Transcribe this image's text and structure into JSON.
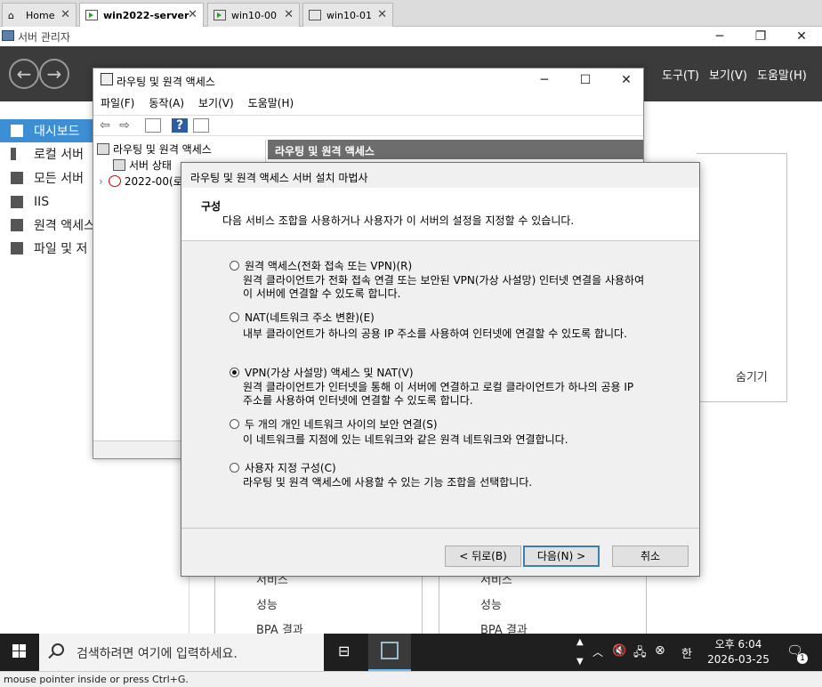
{
  "vm_tabs": [
    {
      "label": "Home"
    },
    {
      "label": "win2022-server"
    },
    {
      "label": "win10-00"
    },
    {
      "label": "win10-01"
    }
  ],
  "server_manager": {
    "title": "서버 관리자",
    "menus": [
      "도구(T)",
      "보기(V)",
      "도움말(H)"
    ],
    "nav": [
      "대시보드",
      "로컬 서버",
      "모든 서버",
      "IIS",
      "원격 액세스",
      "파일 및 저"
    ],
    "hide_label": "숨기기",
    "tile_items_left": [
      "서비스",
      "성능",
      "BPA 결과"
    ],
    "tile_items_right": [
      "서비스",
      "성능",
      "BPA 결과"
    ]
  },
  "rra_window": {
    "title": "라우팅 및 원격 액세스",
    "menus": [
      "파일(F)",
      "동작(A)",
      "보기(V)",
      "도움말(H)"
    ],
    "tree": [
      "라우팅 및 원격 액세스",
      "서버 상태",
      "2022-00(로"
    ],
    "pane_header": "라우팅 및 원격 액세스"
  },
  "wizard": {
    "title": "라우팅 및 원격 액세스 서버 설치 마법사",
    "heading": "구성",
    "description": "다음 서비스 조합을 사용하거나 사용자가 이 서버의 설정을 지정할 수 있습니다.",
    "options": [
      {
        "label": "원격 액세스(전화 접속 또는 VPN)(R)",
        "desc1": "원격 클라이언트가 전화 접속 연결 또는 보안된 VPN(가상 사설망) 인터넷 연결을 사용하여",
        "desc2": "이 서버에 연결할 수 있도록 합니다."
      },
      {
        "label": "NAT(네트워크 주소 변환)(E)",
        "desc1": "내부 클라이언트가 하나의 공용 IP 주소를 사용하여 인터넷에 연결할 수 있도록 합니다.",
        "desc2": ""
      },
      {
        "label": "VPN(가상 사설망) 액세스 및 NAT(V)",
        "desc1": "원격 클라이언트가 인터넷을 통해 이 서버에 연결하고 로컬 클라이언트가 하나의 공용 IP",
        "desc2": "주소를 사용하여 인터넷에 연결할 수 있도록 합니다."
      },
      {
        "label": "두 개의 개인 네트워크 사이의 보안 연결(S)",
        "desc1": "이 네트워크를 지점에 있는 네트워크와 같은 원격 네트워크와 연결합니다.",
        "desc2": ""
      },
      {
        "label": "사용자 지정 구성(C)",
        "desc1": "라우팅 및 원격 액세스에 사용할 수 있는 기능 조합을 선택합니다.",
        "desc2": ""
      }
    ],
    "selected_option": 2,
    "buttons": {
      "back": "< 뒤로(B)",
      "next": "다음(N) >",
      "cancel": "취소"
    }
  },
  "taskbar": {
    "search_placeholder": "검색하려면 여기에 입력하세요.",
    "time": "오후 6:04",
    "date": "2026-03-25",
    "ime": "한",
    "notification_count": "1"
  },
  "vm_status": "mouse pointer inside or press Ctrl+G."
}
